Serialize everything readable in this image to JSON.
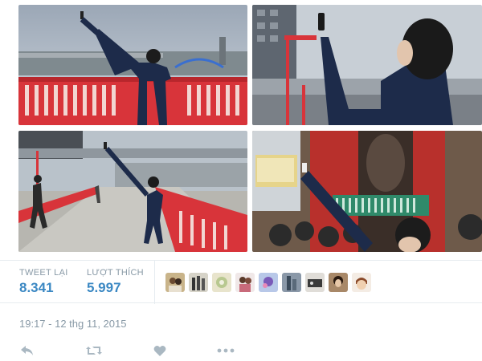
{
  "photos": [
    {
      "alt_icon": "photo"
    },
    {
      "alt_icon": "photo"
    },
    {
      "alt_icon": "photo"
    },
    {
      "alt_icon": "photo"
    }
  ],
  "stats": {
    "retweets_label": "TWEET LẠI",
    "retweets_value": "8.341",
    "likes_label": "LƯỢT THÍCH",
    "likes_value": "5.997"
  },
  "avatars": [
    {
      "color": "#c9b48a"
    },
    {
      "color": "#8a8f7a"
    },
    {
      "color": "#d8c9a8"
    },
    {
      "color": "#b89aa0"
    },
    {
      "color": "#7a6ab8"
    },
    {
      "color": "#6a7a90"
    },
    {
      "color": "#3a3a3a"
    },
    {
      "color": "#5a4a3a"
    },
    {
      "color": "#d8b898"
    }
  ],
  "timestamp": "19:17 - 12 thg 11, 2015",
  "actions": {
    "reply_icon": "reply-icon",
    "retweet_icon": "retweet-icon",
    "like_icon": "heart-icon",
    "more_icon": "more-icon"
  },
  "colors": {
    "accent": "#3b88c3",
    "muted": "#8899a6",
    "bridge_red": "#d8343a"
  }
}
